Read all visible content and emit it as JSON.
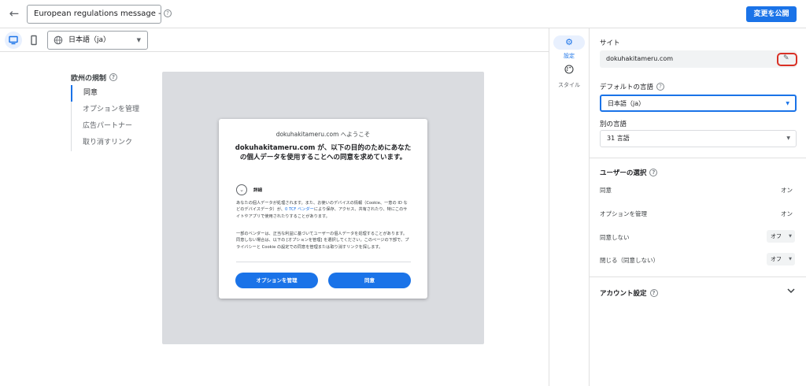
{
  "topbar": {
    "back_icon": "arrow-back-icon",
    "title_value": "European regulations message - dokuha",
    "publish_label": "変更を公開",
    "accent": "#1a73e8"
  },
  "toolbar": {
    "language_value": "日本語（ja）"
  },
  "leftnav": {
    "heading": "欧州の規制",
    "items": [
      {
        "label": "同意"
      },
      {
        "label": "オプションを管理"
      },
      {
        "label": "広告パートナー"
      },
      {
        "label": "取り消すリンク"
      }
    ]
  },
  "dialog": {
    "welcome": "dokuhakitameru.com へようこそ",
    "title": "dokuhakitameru.com が、以下の目的のためにあなたの個人データを使用することへの同意を求めています。",
    "details_label": "詳細",
    "para1_before": "あなたの個人データが処理されます。また、お使いのデバイスの情報（Cookie、一意の ID などのデバイスデータ）が、",
    "para1_link": "0 TCF ベンダー",
    "para1_after": "により保存、アクセス、共有されたり、特にこのサイトやアプリで使用されたりすることがあります。",
    "para2": "一部のベンダーは、正当な利益に基づいてユーザーの個人データを処理することがあります。同意しない場合は、以下の [オプションを管理] を選択してください。このページの下部で、プライバシーと Cookie の設定での同意を管理または取り消すリンクを探します。",
    "manage_label": "オプションを管理",
    "accept_label": "同意"
  },
  "rail": {
    "settings_label": "設定",
    "style_label": "スタイル"
  },
  "panel": {
    "site_label": "サイト",
    "site_value": "dokuhakitameru.com",
    "default_lang_label": "デフォルトの言語",
    "default_lang_value": "日本語（ja）",
    "other_lang_label": "別の言語",
    "other_lang_value": "31 言語",
    "user_choice_label": "ユーザーの選択",
    "choices": [
      {
        "label": "同意",
        "value": "オン"
      },
      {
        "label": "オプションを管理",
        "value": "オン"
      },
      {
        "label": "同意しない",
        "value": "オフ"
      },
      {
        "label": "閉じる（同意しない）",
        "value": "オフ"
      }
    ],
    "account_label": "アカウント設定",
    "highlight_color": "#d93025"
  }
}
